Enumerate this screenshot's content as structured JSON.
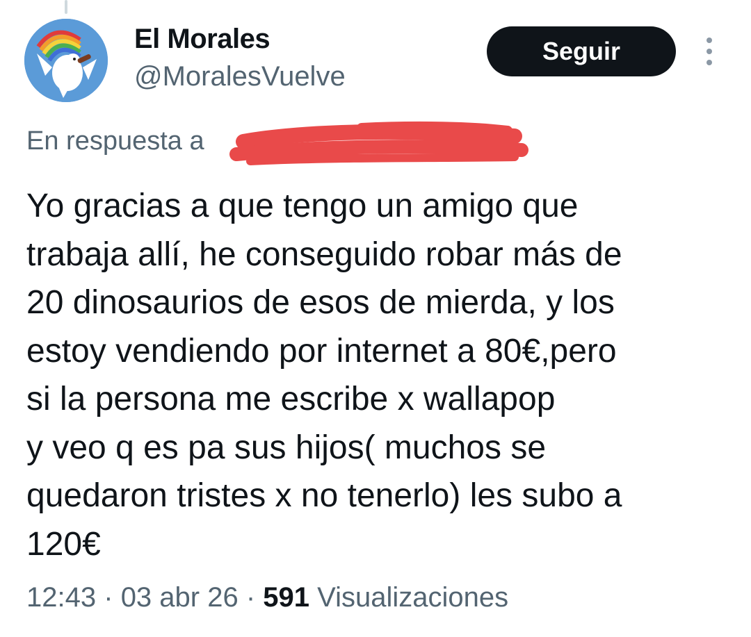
{
  "user": {
    "name": "El Morales",
    "handle": "@MoralesVuelve",
    "avatar_icon": "dove-with-rainbow-avatar"
  },
  "actions": {
    "follow_label": "Seguir",
    "more_icon": "more-vertical-icon"
  },
  "reply": {
    "prefix": "En respuesta a",
    "redacted": true
  },
  "tweet": {
    "lines": [
      "Yo gracias a que tengo un amigo que",
      "trabaja allí, he conseguido robar más de",
      "20 dinosaurios de esos de mierda, y los",
      "estoy vendiendo por internet a 80€,pero",
      "si la persona me escribe x wallapop",
      "y veo q es pa sus hijos( muchos se",
      "quedaron tristes x no tenerlo) les subo a",
      "120€"
    ]
  },
  "meta": {
    "time": "12:43",
    "sep1": "·",
    "date": "03 abr 26",
    "sep2": "·",
    "views_count": "591",
    "views_label": "Visualizaciones"
  },
  "colors": {
    "button_bg": "#0f1419",
    "secondary_text": "#536471",
    "redaction": "#e94a4a",
    "avatar_bg": "#5b9bd8"
  }
}
